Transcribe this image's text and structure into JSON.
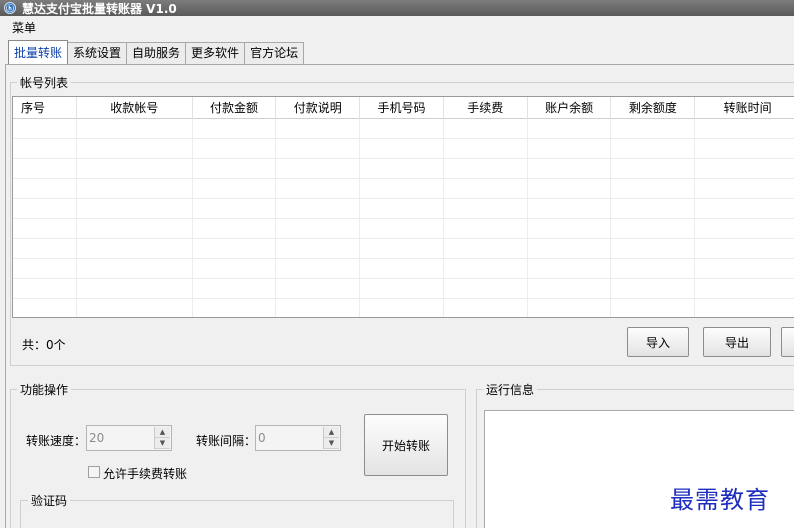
{
  "window": {
    "title": "慧达支付宝批量转账器 V1.0",
    "icon": "app-logo-icon"
  },
  "menu": {
    "items": [
      "菜单"
    ]
  },
  "tabs": [
    {
      "label": "批量转账",
      "active": true
    },
    {
      "label": "系统设置"
    },
    {
      "label": "自助服务"
    },
    {
      "label": "更多软件"
    },
    {
      "label": "官方论坛"
    }
  ],
  "account_list": {
    "title": "帐号列表",
    "columns": [
      "序号",
      "收款帐号",
      "付款金额",
      "付款说明",
      "手机号码",
      "手续费",
      "账户余额",
      "剩余额度",
      "转账时间"
    ],
    "count_text": "共：0个"
  },
  "buttons": {
    "import": "导入",
    "export": "导出",
    "start": "开始转账"
  },
  "operations": {
    "title": "功能操作",
    "speed_label": "转账速度：",
    "speed_value": "20",
    "interval_label": "转账间隔：",
    "interval_value": "0",
    "allow_fee_label": "允许手续费转账"
  },
  "verify": {
    "title": "验证码"
  },
  "run_info": {
    "title": "运行信息"
  },
  "watermark": "最需教育"
}
